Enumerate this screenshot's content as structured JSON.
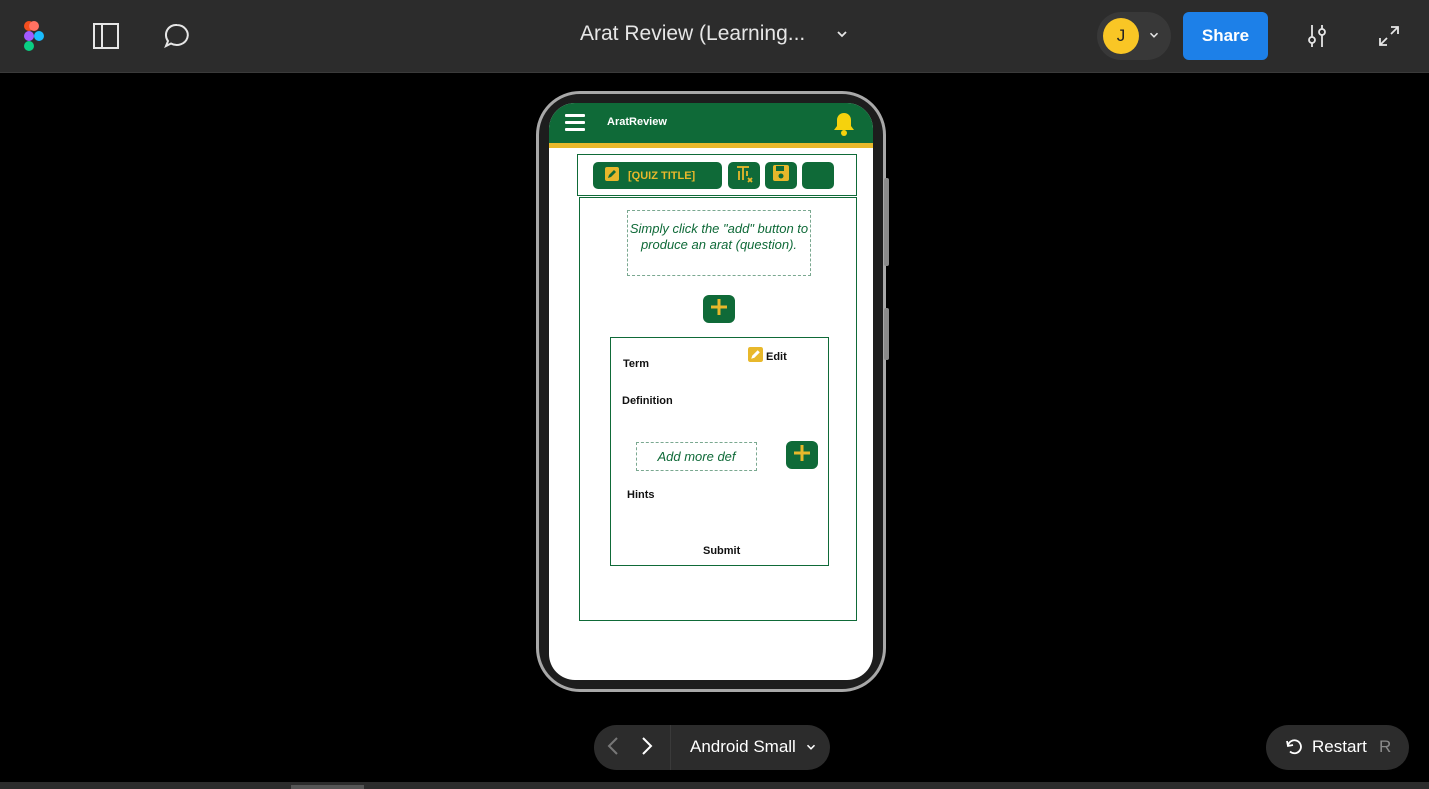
{
  "toolbar": {
    "title": "Arat Review (Learning...",
    "avatar_initial": "J",
    "share_label": "Share"
  },
  "prototype": {
    "app_name": "AratReview",
    "quiz_title": "[QUIZ TITLE]",
    "instruction": "Simply click the \"add\" button to produce an arat (question).",
    "card": {
      "edit_label": "Edit",
      "term_label": "Term",
      "definition_label": "Definition",
      "add_more_placeholder": "Add more def",
      "hints_label": "Hints",
      "submit_label": "Submit"
    }
  },
  "bottom": {
    "device_name": "Android Small",
    "restart_label": "Restart",
    "restart_shortcut": "R"
  },
  "colors": {
    "app_green": "#0f6a38",
    "app_gold": "#e8b82b",
    "share_blue": "#1d80e8",
    "avatar_yellow": "#f9c625"
  }
}
